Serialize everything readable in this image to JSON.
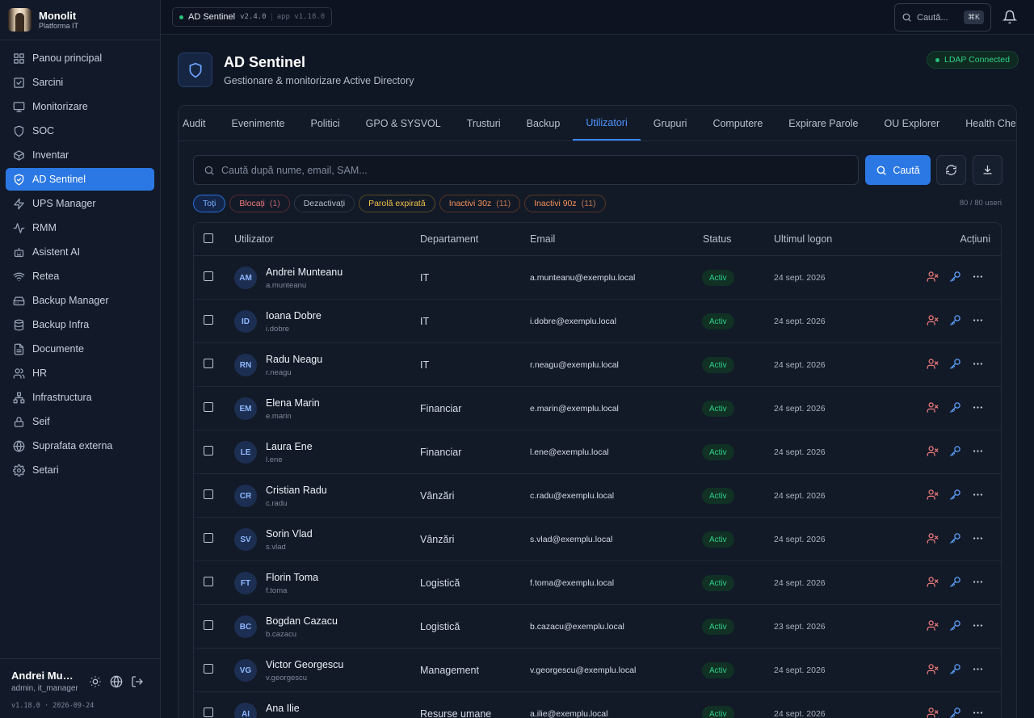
{
  "brand": {
    "name": "Monolit",
    "subtitle": "Platforma IT"
  },
  "nav": [
    {
      "label": "Panou principal",
      "icon": "grid-icon"
    },
    {
      "label": "Sarcini",
      "icon": "checkbox-icon"
    },
    {
      "label": "Monitorizare",
      "icon": "monitor-icon"
    },
    {
      "label": "SOC",
      "icon": "shield-icon"
    },
    {
      "label": "Inventar",
      "icon": "box-icon"
    },
    {
      "label": "AD Sentinel",
      "icon": "shield-check-icon",
      "active": true
    },
    {
      "label": "UPS Manager",
      "icon": "bolt-icon"
    },
    {
      "label": "RMM",
      "icon": "activity-icon"
    },
    {
      "label": "Asistent AI",
      "icon": "robot-icon"
    },
    {
      "label": "Retea",
      "icon": "wifi-icon"
    },
    {
      "label": "Backup Manager",
      "icon": "hard-drive-icon"
    },
    {
      "label": "Backup Infra",
      "icon": "database-icon"
    },
    {
      "label": "Documente",
      "icon": "document-icon"
    },
    {
      "label": "HR",
      "icon": "users-icon"
    },
    {
      "label": "Infrastructura",
      "icon": "network-icon"
    },
    {
      "label": "Seif",
      "icon": "lock-icon"
    },
    {
      "label": "Suprafata externa",
      "icon": "globe-icon"
    },
    {
      "label": "Setari",
      "icon": "gear-icon"
    }
  ],
  "user": {
    "name": "Andrei Munteanu",
    "role": "admin, it_manager"
  },
  "footer_version": "v1.18.0 · 2026-09-24",
  "topbar": {
    "app_name": "AD Sentinel",
    "app_version": "v2.4.0",
    "platform_version": "app v1.18.0",
    "search_placeholder": "Caută...",
    "shortcut": "⌘K"
  },
  "header": {
    "title": "AD Sentinel",
    "subtitle": "Gestionare & monitorizare Active Directory",
    "ldap_status": "LDAP Connected"
  },
  "tabs": [
    "Audit",
    "Evenimente",
    "Politici",
    "GPO & SYSVOL",
    "Trusturi",
    "Backup",
    "Utilizatori",
    "Grupuri",
    "Computere",
    "Expirare Parole",
    "OU Explorer",
    "Health Check"
  ],
  "active_tab": "Utilizatori",
  "search": {
    "placeholder": "Caută după nume, email, SAM...",
    "button": "Caută"
  },
  "filters": [
    {
      "label": "Toți",
      "count": "",
      "tone": "all"
    },
    {
      "label": "Blocați",
      "count": "(1)",
      "tone": "red"
    },
    {
      "label": "Dezactivați",
      "count": "",
      "tone": "neutral"
    },
    {
      "label": "Parolă expirată",
      "count": "",
      "tone": "yellow"
    },
    {
      "label": "Inactivi 30z",
      "count": "(11)",
      "tone": "orange"
    },
    {
      "label": "Inactivi 90z",
      "count": "(11)",
      "tone": "orange"
    }
  ],
  "user_count": "80 / 80 useri",
  "table": {
    "headers": {
      "user": "Utilizator",
      "dept": "Departament",
      "email": "Email",
      "status": "Status",
      "logon": "Ultimul logon",
      "actions": "Acțiuni"
    },
    "rows": [
      {
        "initials": "AM",
        "name": "Andrei Munteanu",
        "sam": "a.munteanu",
        "dept": "IT",
        "email": "a.munteanu@exemplu.local",
        "status": "Activ",
        "logon": "24 sept. 2026"
      },
      {
        "initials": "ID",
        "name": "Ioana Dobre",
        "sam": "i.dobre",
        "dept": "IT",
        "email": "i.dobre@exemplu.local",
        "status": "Activ",
        "logon": "24 sept. 2026"
      },
      {
        "initials": "RN",
        "name": "Radu Neagu",
        "sam": "r.neagu",
        "dept": "IT",
        "email": "r.neagu@exemplu.local",
        "status": "Activ",
        "logon": "24 sept. 2026"
      },
      {
        "initials": "EM",
        "name": "Elena Marin",
        "sam": "e.marin",
        "dept": "Financiar",
        "email": "e.marin@exemplu.local",
        "status": "Activ",
        "logon": "24 sept. 2026"
      },
      {
        "initials": "LE",
        "name": "Laura Ene",
        "sam": "l.ene",
        "dept": "Financiar",
        "email": "l.ene@exemplu.local",
        "status": "Activ",
        "logon": "24 sept. 2026"
      },
      {
        "initials": "CR",
        "name": "Cristian Radu",
        "sam": "c.radu",
        "dept": "Vânzări",
        "email": "c.radu@exemplu.local",
        "status": "Activ",
        "logon": "24 sept. 2026"
      },
      {
        "initials": "SV",
        "name": "Sorin Vlad",
        "sam": "s.vlad",
        "dept": "Vânzări",
        "email": "s.vlad@exemplu.local",
        "status": "Activ",
        "logon": "24 sept. 2026"
      },
      {
        "initials": "FT",
        "name": "Florin Toma",
        "sam": "f.toma",
        "dept": "Logistică",
        "email": "f.toma@exemplu.local",
        "status": "Activ",
        "logon": "24 sept. 2026"
      },
      {
        "initials": "BC",
        "name": "Bogdan Cazacu",
        "sam": "b.cazacu",
        "dept": "Logistică",
        "email": "b.cazacu@exemplu.local",
        "status": "Activ",
        "logon": "23 sept. 2026"
      },
      {
        "initials": "VG",
        "name": "Victor Georgescu",
        "sam": "v.georgescu",
        "dept": "Management",
        "email": "v.georgescu@exemplu.local",
        "status": "Activ",
        "logon": "24 sept. 2026"
      },
      {
        "initials": "AI",
        "name": "Ana Ilie",
        "sam": "a.ilie",
        "dept": "Resurse umane",
        "email": "a.ilie@exemplu.local",
        "status": "Activ",
        "logon": "24 sept. 2026"
      }
    ]
  },
  "colors": {
    "accent": "#2b78e4",
    "success": "#2fd08a",
    "danger": "#f07b7b",
    "warning": "#f1c04a",
    "background": "#0f1624"
  }
}
